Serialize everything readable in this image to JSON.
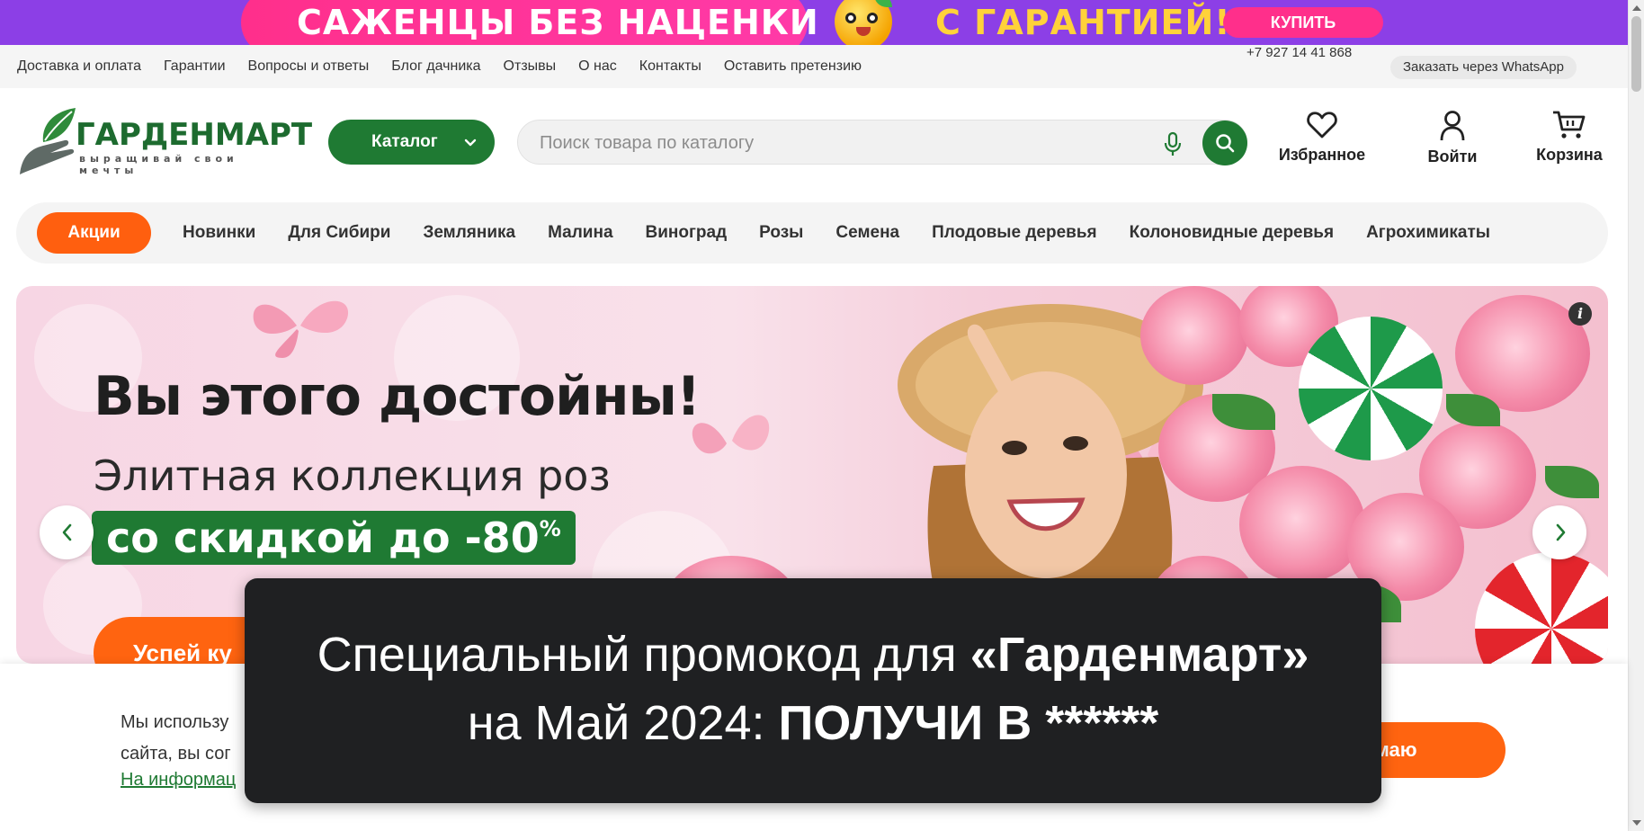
{
  "promo_banner": {
    "left_text": "САЖЕНЦЫ БЕЗ НАЦЕНКИ",
    "right_text": "С ГАРАНТИЕЙ!",
    "buy_label": "КУПИТЬ",
    "background_color": "#8c3fe6",
    "accent_color": "#ff2f8b"
  },
  "util_nav": {
    "links": [
      "Доставка и оплата",
      "Гарантии",
      "Вопросы и ответы",
      "Блог дачника",
      "Отзывы",
      "О нас",
      "Контакты",
      "Оставить претензию"
    ],
    "phone": "+7 927 14 41 868",
    "whatsapp_label": "Заказать через WhatsApp"
  },
  "header": {
    "logo_name": "ГАРДЕНМАРТ",
    "logo_tagline": "выращивай свои мечты",
    "catalog_label": "Каталог",
    "search_placeholder": "Поиск товара по каталогу",
    "favorites_label": "Избранное",
    "login_label": "Войти",
    "cart_label": "Корзина",
    "brand_color": "#1f7a33"
  },
  "category_nav": {
    "sale_label": "Акции",
    "items": [
      "Новинки",
      "Для Сибири",
      "Земляника",
      "Малина",
      "Виноград",
      "Розы",
      "Семена",
      "Плодовые деревья",
      "Колоновидные деревья",
      "Агрохимикаты"
    ],
    "sale_color": "#ff5f0f"
  },
  "hero": {
    "title": "Вы этого достойны!",
    "subtitle": "Элитная коллекция роз",
    "discount_text": "со скидкой до -80",
    "discount_suffix": "%",
    "cta_label": "Успей ку",
    "info_icon": "info-icon",
    "prev_icon": "chevron-left-icon",
    "next_icon": "chevron-right-icon"
  },
  "cookie": {
    "text": "Мы использу",
    "text_line2": "сайта, вы сог",
    "link": "На информац",
    "accept_label": "маю"
  },
  "promo_overlay": {
    "line1_prefix": "Специальный промокод для ",
    "line1_bold": "«Гарденмарт»",
    "line2_prefix": "на Май 2024: ",
    "line2_bold": "ПОЛУЧИ В ******"
  }
}
